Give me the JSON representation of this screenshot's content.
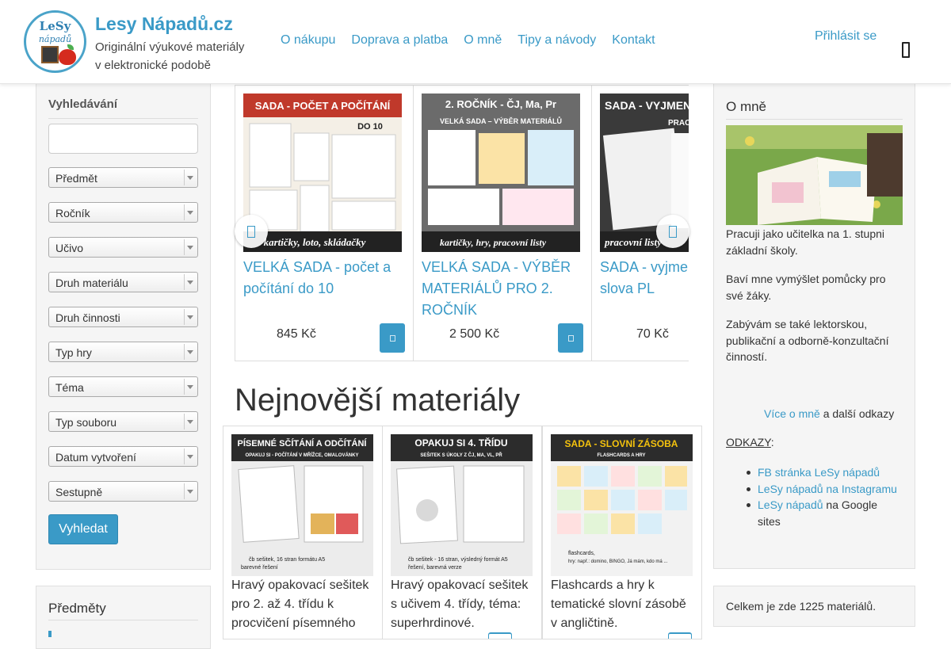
{
  "header": {
    "site_title": "Lesy Nápadů.cz",
    "subtitle_line1": "Originální výukové materiály",
    "subtitle_line2": "v elektronické podobě",
    "logo_text_top": "LeSy",
    "logo_text_sub": "nápadů",
    "nav": [
      "O nákupu",
      "Doprava a platba",
      "O mně",
      "Tipy a návody",
      "Kontakt"
    ],
    "login": "Přihlásit se"
  },
  "search_panel": {
    "title": "Vyhledávání",
    "query_value": "",
    "filters": [
      "Předmět",
      "Ročník",
      "Učivo",
      "Druh materiálu",
      "Druh činnosti",
      "Typ hry",
      "Téma",
      "Typ souboru",
      "Datum vytvoření",
      "Sestupně"
    ],
    "submit_label": "Vyhledat"
  },
  "subjects_panel": {
    "title": "Předměty"
  },
  "carousel": [
    {
      "title": "VELKÁ SADA - počet a počítání do 10",
      "price": "845 Kč",
      "img_title": "SADA - POČET A POČÍTÁNÍ",
      "img_sub": "DO 10",
      "img_footer": "kartičky, loto, skládačky",
      "img_bg": "#c0392b"
    },
    {
      "title": "VELKÁ SADA - VÝBĚR MATERIÁLŮ PRO 2. ROČNÍK",
      "price": "2 500 Kč",
      "img_title": "2. ROČNÍK - ČJ, Ma, Pr",
      "img_sub": "VELKÁ SADA – VÝBĚR MATERIÁLŮ",
      "img_footer": "kartičky, hry, pracovní listy",
      "img_bg": "#555555"
    },
    {
      "title": "SADA - vyjmenovaná slova PL",
      "price": "70 Kč",
      "img_title": "SADA - VYJMENO",
      "img_sub": "PRACOVNÍ",
      "img_footer": "pracovní listy",
      "img_bg": "#2c2c2c"
    }
  ],
  "newest": {
    "heading": "Nejnovější materiály",
    "items": [
      {
        "img_title": "PÍSEMNÉ SČÍTÁNÍ A ODČÍTÁNÍ",
        "img_sub": "OPAKUJ SI - POČÍTÁNÍ V MŘÍŽCE, OMALOVÁNKY",
        "img_foot": "čb sešitek, 16 stran formátu A5",
        "img_foot2": "barevné řešení",
        "desc": "Hravý opakovací sešitek pro 2. až 4. třídu k procvičení písemného",
        "img_bg": "#2c2c2c"
      },
      {
        "img_title": "OPAKUJ SI 4. TŘÍDU",
        "img_sub": "SEŠITEK S ÚKOLY Z ČJ, MA, VL, PŘ",
        "img_foot": "čb sešitek - 16 stran, výsledný formát A5",
        "img_foot2": "řešení, barevná verze",
        "desc": "Hravý opakovací sešitek s učivem 4. třídy, téma: superhrdinové.",
        "img_bg": "#2c2c2c"
      },
      {
        "img_title": "SADA - SLOVNÍ ZÁSOBA",
        "img_sub": "FLASHCARDS A HRY",
        "img_foot": "flashcards,",
        "img_foot2": "hry: např.: domino, BINGO, Já mám, kdo má ...",
        "desc": "Flashcards a hry k tematické slovní zásobě v angličtině.",
        "img_bg": "#2c2c2c"
      }
    ]
  },
  "about": {
    "title": "O mně",
    "p1": "Pracuji jako učitelka na 1. stupni základní školy.",
    "p2": "Baví mne vymýšlet pomůcky pro své žáky.",
    "p3": "Zabývám se také lektorskou, publikační a odborně-konzultační činností.",
    "more_link": "Více o mně",
    "more_rest": " a další odkazy",
    "links_title": "ODKAZY",
    "links_colon": ":",
    "link1": "FB stránka LeSy nápadů",
    "link2": "LeSy nápadů na Instagramu",
    "link3_link": "LeSy nápadů",
    "link3_rest": " na Google sites"
  },
  "count": {
    "text": "Celkem je zde 1225 materiálů."
  },
  "icons": {
    "menu": "menu-icon",
    "cart": "cart-icon",
    "prev": "chevron-left-icon",
    "next": "chevron-right-icon",
    "caret": "dropdown-caret-icon"
  },
  "colors": {
    "accent": "#3a9ac7",
    "panel_bg": "#f5f5f5"
  }
}
